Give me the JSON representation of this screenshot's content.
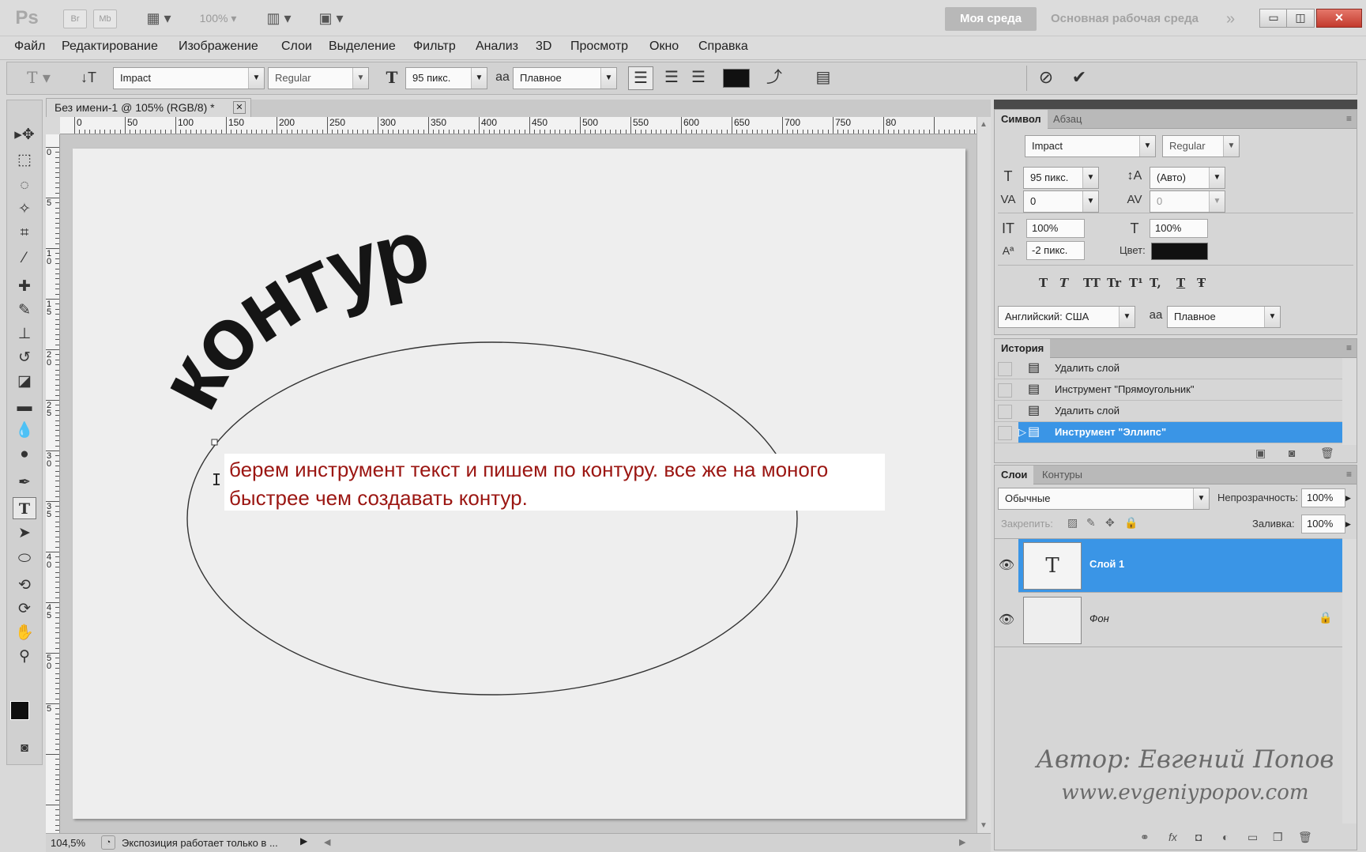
{
  "titlebar": {
    "logo": "Ps",
    "bridge": "Br",
    "minibridge": "Mb",
    "zoom": "100%",
    "workspace_active": "Моя среда",
    "workspace_main": "Основная рабочая среда",
    "more": "»"
  },
  "menu": [
    "Файл",
    "Редактирование",
    "Изображение",
    "Слои",
    "Выделение",
    "Фильтр",
    "Анализ",
    "3D",
    "Просмотр",
    "Окно",
    "Справка"
  ],
  "options": {
    "font_family": "Impact",
    "font_style": "Regular",
    "font_size": "95 пикс.",
    "antialias_icon": "aa",
    "antialias": "Плавное"
  },
  "document": {
    "tab_title": "Без имени-1 @ 105% (RGB/8) *",
    "ruler_h": [
      "0",
      "50",
      "100",
      "150",
      "200",
      "250",
      "300",
      "350",
      "400",
      "450",
      "500",
      "550",
      "600",
      "650",
      "700",
      "750",
      "80"
    ],
    "ruler_v": [
      "0",
      "5",
      "1 0",
      "1 5",
      "2 0",
      "2 5",
      "3 0",
      "3 5",
      "4 0",
      "4 5",
      "5 0",
      "5"
    ],
    "path_text": "контур",
    "zoom_status": "104,5%",
    "status_text": "Экспозиция работает только в ..."
  },
  "tutorial": {
    "line1": "берем инструмент текст и пишем по контуру. все же на моного",
    "line2": "быстрее чем создавать контур."
  },
  "character_panel": {
    "tab_character": "Символ",
    "tab_paragraph": "Абзац",
    "font_family": "Impact",
    "font_style": "Regular",
    "font_size": "95 пикс.",
    "leading": "(Авто)",
    "kerning": "0",
    "tracking": "0",
    "vscale": "100%",
    "hscale": "100%",
    "baseline": "-2 пикс.",
    "color_label": "Цвет:",
    "color": "#111111",
    "style_buttons": [
      "T",
      "T",
      "TT",
      "Tr",
      "T¹",
      "T,",
      "T",
      "Ŧ"
    ],
    "language": "Английский: США",
    "antialias_icon": "aa",
    "antialias": "Плавное"
  },
  "history_panel": {
    "title": "История",
    "items": [
      "Удалить слой",
      "Инструмент \"Прямоугольник\"",
      "Удалить слой",
      "Инструмент \"Эллипс\""
    ]
  },
  "layers_panel": {
    "tab_layers": "Слои",
    "tab_paths": "Контуры",
    "blend_mode": "Обычные",
    "opacity_label": "Непрозрачность:",
    "opacity": "100%",
    "lock_label": "Закрепить:",
    "fill_label": "Заливка:",
    "fill": "100%",
    "layers": [
      {
        "name": "Слой 1",
        "thumb": "T"
      },
      {
        "name": "Фон",
        "thumb": ""
      }
    ]
  },
  "watermark": {
    "line1": "Автор: Евгений Попов",
    "line2": "www.evgeniypopov.com"
  }
}
